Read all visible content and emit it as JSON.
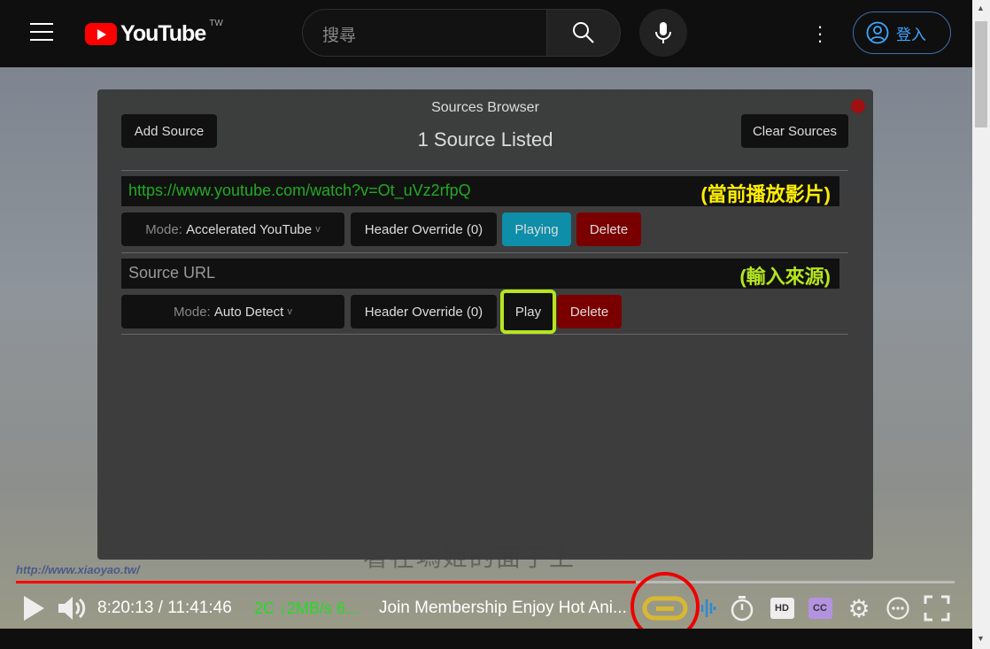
{
  "header": {
    "logo_text": "YouTube",
    "country_code": "TW",
    "search_placeholder": "搜尋",
    "sign_in": "登入"
  },
  "panel": {
    "title": "Sources Browser",
    "count": "1 Source Listed",
    "add_source": "Add Source",
    "clear_sources": "Clear Sources",
    "sources": [
      {
        "url": "https://www.youtube.com/watch?v=Ot_uVz2rfpQ",
        "annotation": "(當前播放影片)",
        "mode_label": "Mode:",
        "mode_value": "Accelerated YouTube",
        "header_override": "Header Override (0)",
        "action": "Playing",
        "delete": "Delete"
      },
      {
        "url_placeholder": "Source URL",
        "annotation": "(輸入來源)",
        "mode_label": "Mode:",
        "mode_value": "Auto Detect",
        "header_override": "Header Override (0)",
        "action": "Play",
        "delete": "Delete"
      }
    ]
  },
  "video": {
    "subtitle": "看在瑪姬的面子上",
    "watermark": "http://www.xiaoyao.tw/",
    "progress_percent": 66
  },
  "player": {
    "time": "8:20:13 / 11:41:46",
    "stats": "2C ↓2MB/s 6...",
    "title": "Join Membership Enjoy Hot Ani...",
    "hd": "HD",
    "cc": "CC"
  },
  "colors": {
    "accent_red": "#ff0000",
    "url_green": "#22aa22",
    "annotation_yellow": "#ffee00",
    "annotation_lime": "#b5e61d",
    "playing": "#0e8ea8",
    "delete": "#7a0000"
  }
}
